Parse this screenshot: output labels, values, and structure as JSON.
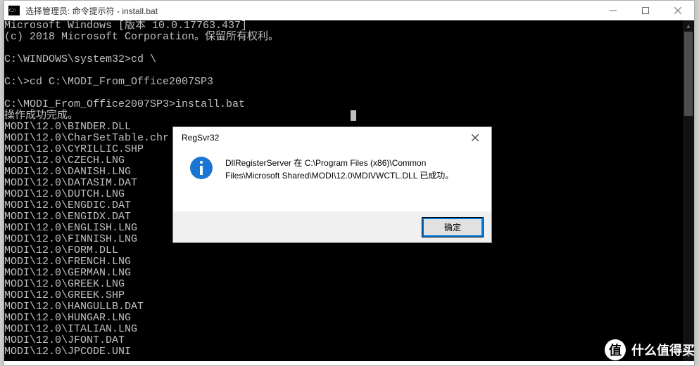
{
  "window": {
    "title": "选择管理员: 命令提示符 - install.bat"
  },
  "terminal": {
    "lines": [
      "Microsoft Windows [版本 10.0.17763.437]",
      "(c) 2018 Microsoft Corporation。保留所有权利。",
      "",
      "C:\\WINDOWS\\system32>cd \\",
      "",
      "C:\\>cd C:\\MODI_From_Office2007SP3",
      "",
      "C:\\MODI_From_Office2007SP3>install.bat",
      "操作成功完成。",
      "MODI\\12.0\\BINDER.DLL",
      "MODI\\12.0\\CharSetTable.chr",
      "MODI\\12.0\\CYRILLIC.SHP",
      "MODI\\12.0\\CZECH.LNG",
      "MODI\\12.0\\DANISH.LNG",
      "MODI\\12.0\\DATASIM.DAT",
      "MODI\\12.0\\DUTCH.LNG",
      "MODI\\12.0\\ENGDIC.DAT",
      "MODI\\12.0\\ENGIDX.DAT",
      "MODI\\12.0\\ENGLISH.LNG",
      "MODI\\12.0\\FINNISH.LNG",
      "MODI\\12.0\\FORM.DLL",
      "MODI\\12.0\\FRENCH.LNG",
      "MODI\\12.0\\GERMAN.LNG",
      "MODI\\12.0\\GREEK.LNG",
      "MODI\\12.0\\GREEK.SHP",
      "MODI\\12.0\\HANGULLB.DAT",
      "MODI\\12.0\\HUNGAR.LNG",
      "MODI\\12.0\\ITALIAN.LNG",
      "MODI\\12.0\\JFONT.DAT",
      "MODI\\12.0\\JPCODE.UNI"
    ]
  },
  "cursor_line": 8,
  "dialog": {
    "title": "RegSvr32",
    "message": "DllRegisterServer 在 C:\\Program Files (x86)\\Common Files\\Microsoft Shared\\MODI\\12.0\\MDIVWCTL.DLL 已成功。",
    "ok_label": "确定"
  },
  "watermark": {
    "badge": "值",
    "text": "什么值得买"
  }
}
